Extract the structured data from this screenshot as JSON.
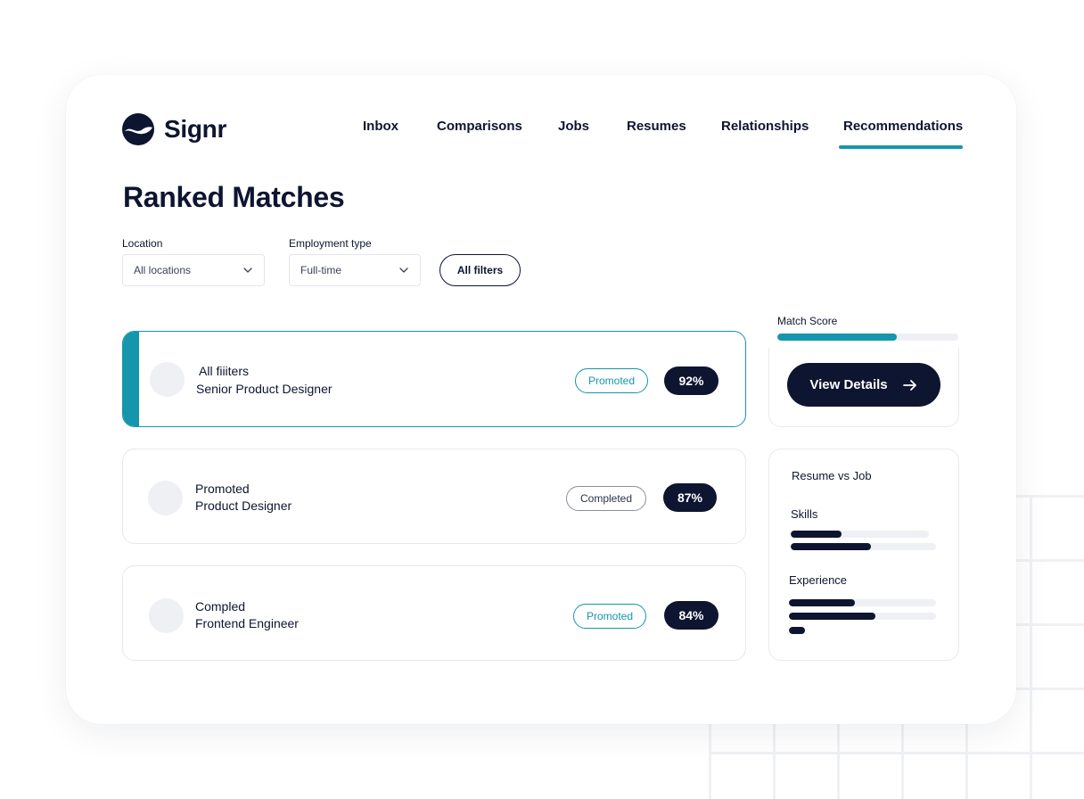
{
  "app": {
    "name": "Signr",
    "logo_icon": "signr-logo-icon"
  },
  "nav": {
    "items": [
      {
        "label": "Inbox",
        "active": false
      },
      {
        "label": "Comparisons",
        "active": false
      },
      {
        "label": "Jobs",
        "active": false
      },
      {
        "label": "Resumes",
        "active": false
      },
      {
        "label": "Relationships",
        "active": false
      },
      {
        "label": "Recommendations",
        "active": true
      }
    ]
  },
  "page": {
    "title": "Ranked Matches"
  },
  "filters": {
    "location": {
      "label": "Location",
      "value": "All locations"
    },
    "employment_type": {
      "label": "Employment type",
      "value": "Full-time"
    },
    "all_filters_label": "All filters"
  },
  "matches": [
    {
      "status": "All fiiiters",
      "role": "Senior Product Designer",
      "tag": "Promoted",
      "tag_kind": "promoted",
      "score": "92%",
      "active": true
    },
    {
      "status": "Promoted",
      "role": "Product Designer",
      "tag": "Completed",
      "tag_kind": "completed",
      "score": "87%",
      "active": false
    },
    {
      "status": "Compled",
      "role": "Frontend Engineer",
      "tag": "Promoted",
      "tag_kind": "promoted",
      "score": "84%",
      "active": false
    }
  ],
  "match_score": {
    "label": "Match Score",
    "value_fraction": 0.66
  },
  "view_details_label": "View Details",
  "comparison": {
    "title": "Resume vs Job",
    "skills": {
      "label": "Skills",
      "bars": [
        0.37,
        0.55
      ]
    },
    "experience": {
      "label": "Experience",
      "bars": [
        0.45,
        0.59,
        0.11
      ]
    }
  },
  "colors": {
    "accent": "#1596ac",
    "navy": "#0e1530",
    "track": "#eef0f4"
  }
}
